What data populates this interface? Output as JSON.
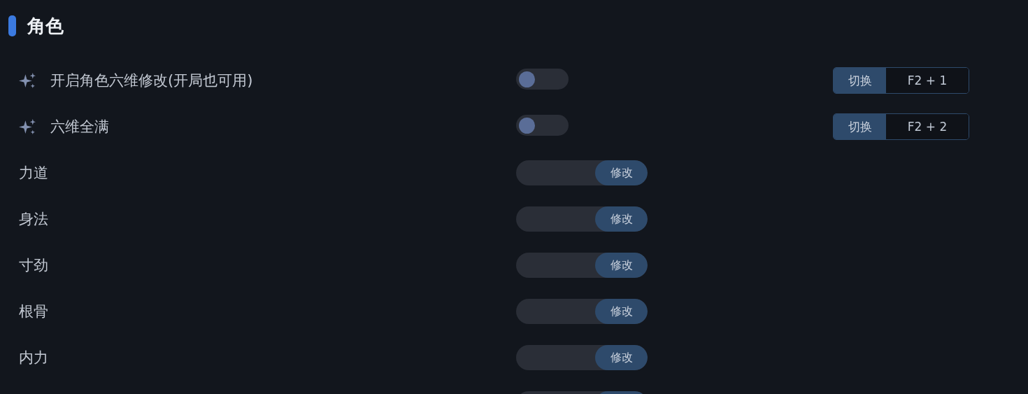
{
  "section": {
    "title": "角色"
  },
  "rows": [
    {
      "kind": "toggle",
      "label": "开启角色六维修改(开局也可用)",
      "on": false,
      "hotkey": {
        "action": "切换",
        "keys": "F2 + 1"
      }
    },
    {
      "kind": "toggle",
      "label": "六维全满",
      "on": false,
      "hotkey": {
        "action": "切换",
        "keys": "F2 + 2"
      }
    },
    {
      "kind": "input",
      "label": "力道",
      "button": "修改"
    },
    {
      "kind": "input",
      "label": "身法",
      "button": "修改"
    },
    {
      "kind": "input",
      "label": "寸劲",
      "button": "修改"
    },
    {
      "kind": "input",
      "label": "根骨",
      "button": "修改"
    },
    {
      "kind": "input",
      "label": "内力",
      "button": "修改"
    },
    {
      "kind": "input"
    }
  ]
}
